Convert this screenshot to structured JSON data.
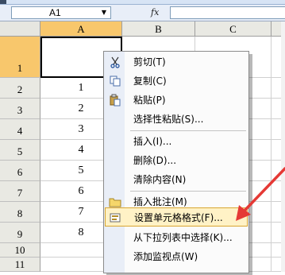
{
  "formula_bar": {
    "name_box": "A1",
    "name_box_arrow": "▼",
    "fx_label": "fx",
    "formula_value": ""
  },
  "columns": [
    "A",
    "B",
    "C"
  ],
  "rows": [
    "1",
    "2",
    "3",
    "4",
    "5",
    "6",
    "7",
    "8",
    "9",
    "10",
    "11"
  ],
  "cells_a": [
    "",
    "1",
    "2",
    "3",
    "4",
    "5",
    "6",
    "7",
    "8",
    "",
    ""
  ],
  "context_menu": {
    "items": [
      {
        "label": "剪切(T)",
        "icon": "scissors-icon"
      },
      {
        "label": "复制(C)",
        "icon": "copy-icon"
      },
      {
        "label": "粘贴(P)",
        "icon": "paste-icon"
      },
      {
        "label": "选择性粘贴(S)...",
        "icon": ""
      },
      {
        "label": "插入(I)...",
        "icon": ""
      },
      {
        "label": "删除(D)...",
        "icon": ""
      },
      {
        "label": "清除内容(N)",
        "icon": ""
      },
      {
        "label": "插入批注(M)",
        "icon": "comment-icon"
      },
      {
        "label": "设置单元格格式(F)...",
        "icon": "format-cells-icon"
      },
      {
        "label": "从下拉列表中选择(K)...",
        "icon": ""
      },
      {
        "label": "添加监视点(W)",
        "icon": ""
      }
    ]
  },
  "colors": {
    "accent_header": "#f8c76c",
    "annotation_arrow": "#e53935",
    "menu_highlight": "#fff2c6"
  }
}
